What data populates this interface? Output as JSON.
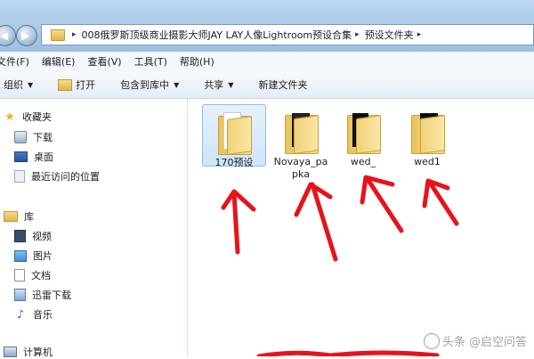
{
  "address_bar": {
    "crumbs": [
      "008俄罗斯顶级商业摄影大师JAY LAY人像Lightroom预设合集",
      "预设文件夹"
    ],
    "separator": "▸"
  },
  "menu": {
    "items": [
      "文件(F)",
      "编辑(E)",
      "查看(V)",
      "工具(T)",
      "帮助(H)"
    ]
  },
  "toolbar": {
    "organize": "组织",
    "open": "打开",
    "include_in_library": "包含到库中",
    "share": "共享",
    "new_folder": "新建文件夹",
    "dropdown_glyph": "▼"
  },
  "sidebar": {
    "favorites": {
      "label": "收藏夹",
      "items": [
        "下载",
        "桌面",
        "最近访问的位置"
      ]
    },
    "libraries": {
      "label": "库",
      "items": [
        "视频",
        "图片",
        "文档",
        "迅雷下载",
        "音乐"
      ]
    },
    "computer": {
      "label": "计算机"
    }
  },
  "files": [
    {
      "name": "170预设",
      "selected": true
    },
    {
      "name": "Novaya_papka",
      "selected": false
    },
    {
      "name": "wed_",
      "selected": false
    },
    {
      "name": "wed1",
      "selected": false
    }
  ],
  "watermark": "头条 @启空问答",
  "colors": {
    "annotation_red": "#e8121b",
    "selection_blue": "#cfe4f9"
  },
  "icons": {
    "back": "back-arrow-icon",
    "forward": "forward-arrow-icon",
    "favorites": "star-icon",
    "folder": "folder-icon"
  }
}
